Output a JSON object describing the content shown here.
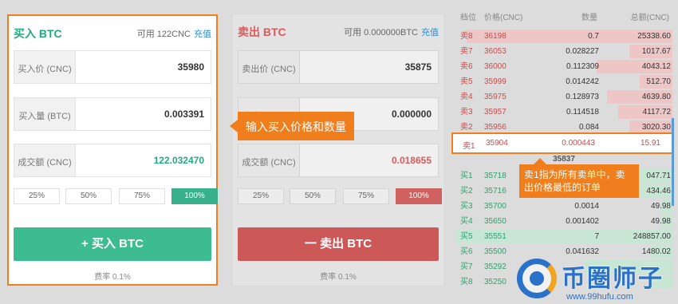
{
  "buy": {
    "title": "买入 BTC",
    "available": "可用 122CNC",
    "recharge": "充值",
    "price_label": "买入价 (CNC)",
    "price": "35980",
    "qty_label": "买入量 (BTC)",
    "qty": "0.003391",
    "total_label": "成交额 (CNC)",
    "total": "122.032470",
    "pcts": [
      "25%",
      "50%",
      "75%",
      "100%"
    ],
    "button": "+ 买入 BTC",
    "fee": "费率 0.1%"
  },
  "sell": {
    "title": "卖出 BTC",
    "available": "可用 0.000000BTC",
    "recharge": "充值",
    "price_label": "卖出价 (CNC)",
    "price": "35875",
    "qty_label": "卖出量 (BTC)",
    "qty": "0.000000",
    "total_label": "成交额 (CNC)",
    "total": "0.018655",
    "pcts": [
      "25%",
      "50%",
      "75%",
      "100%"
    ],
    "button": "一 卖出 BTC",
    "fee": "费率 0.1%"
  },
  "book": {
    "headers": [
      "档位",
      "价格(CNC)",
      "数量",
      "总额(CNC)"
    ],
    "asks": [
      {
        "lab": "卖8",
        "price": "36198",
        "qty": "0.7",
        "total": "25338.60",
        "depth": 0.95
      },
      {
        "lab": "卖7",
        "price": "36053",
        "qty": "0.028227",
        "total": "1017.67",
        "depth": 0.2
      },
      {
        "lab": "卖6",
        "price": "36000",
        "qty": "0.112309",
        "total": "4043.12",
        "depth": 0.35
      },
      {
        "lab": "卖5",
        "price": "35999",
        "qty": "0.014242",
        "total": "512.70",
        "depth": 0.15
      },
      {
        "lab": "卖4",
        "price": "35975",
        "qty": "0.128973",
        "total": "4639.80",
        "depth": 0.3
      },
      {
        "lab": "卖3",
        "price": "35957",
        "qty": "0.114518",
        "total": "4117.72",
        "depth": 0.25
      },
      {
        "lab": "卖2",
        "price": "35956",
        "qty": "0.084",
        "total": "3020.30",
        "depth": 0.2
      }
    ],
    "ask1": {
      "lab": "卖1",
      "price": "35904",
      "qty": "0.000443",
      "total": "15.91"
    },
    "last": "35837",
    "bids": [
      {
        "lab": "买1",
        "price": "35718",
        "qty": "",
        "total": "047.71",
        "depth": 0.2
      },
      {
        "lab": "买2",
        "price": "35716",
        "qty": "",
        "total": "434.46",
        "depth": 0.15
      },
      {
        "lab": "买3",
        "price": "35700",
        "qty": "0.0014",
        "total": "49.98",
        "depth": 0.05
      },
      {
        "lab": "买4",
        "price": "35650",
        "qty": "0.001402",
        "total": "49.98",
        "depth": 0.05
      },
      {
        "lab": "买5",
        "price": "35551",
        "qty": "7",
        "total": "248857.00",
        "depth": 1.0
      },
      {
        "lab": "买6",
        "price": "35500",
        "qty": "0.041632",
        "total": "1480.02",
        "depth": 0.1
      },
      {
        "lab": "买7",
        "price": "35292",
        "qty": "",
        "total": "",
        "depth": 0.4
      },
      {
        "lab": "买8",
        "price": "35250",
        "qty": "",
        "total": "",
        "depth": 0.1
      }
    ]
  },
  "callouts": {
    "input": "输入买入价格和数量",
    "ask1": "卖1指为所有卖单中，卖出价格最低的订单"
  },
  "watermark": {
    "name": "币圈师子",
    "url": "www.99hufu.com"
  }
}
